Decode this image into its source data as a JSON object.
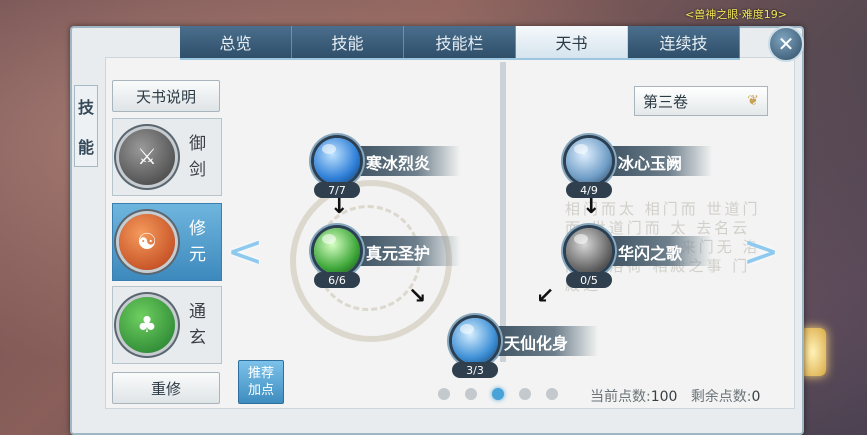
{
  "top_right_text": "<兽神之眼·难度19>",
  "tabs": [
    {
      "label": "总览"
    },
    {
      "label": "技能"
    },
    {
      "label": "技能栏"
    },
    {
      "label": "天书",
      "active": true
    },
    {
      "label": "连续技"
    }
  ],
  "side_title": [
    "技",
    "能"
  ],
  "left": {
    "explain_label": "天书说明",
    "schools": [
      {
        "name_line1": "御",
        "name_line2": "剑",
        "icon": "sword-emblem-icon",
        "color": "#4d4d4d"
      },
      {
        "name_line1": "修",
        "name_line2": "元",
        "icon": "fire-emblem-icon",
        "color": "#d8572a",
        "active": true
      },
      {
        "name_line1": "通",
        "name_line2": "玄",
        "icon": "nature-emblem-icon",
        "color": "#3b9a3d"
      }
    ],
    "reset_label": "重修",
    "recommend_line1": "推荐",
    "recommend_line2": "加点"
  },
  "volume": {
    "label": "第三卷",
    "icon": "chevron-down-icon"
  },
  "skills": [
    {
      "name": "寒冰烈炎",
      "level": "7/7",
      "color": "#2f7fd8"
    },
    {
      "name": "真元圣护",
      "level": "6/6",
      "color": "#3fa83a"
    },
    {
      "name": "天仙化身",
      "level": "3/3",
      "color": "#3d8fd6"
    },
    {
      "name": "冰心玉阙",
      "level": "4/9",
      "color": "#6f9dc6"
    },
    {
      "name": "华闪之歌",
      "level": "0/5",
      "color": "#6a6a6a"
    }
  ],
  "calligraphy": "相门而太 相门而 世道门而 世道门而 太 去名云 英太名云英太 来门无 洛门无 洛荷 相殿之事 门殿之",
  "pagination": {
    "count": 5,
    "active_index": 2
  },
  "points": {
    "current_label": "当前点数:",
    "current_value": "100",
    "remaining_label": "剩余点数:",
    "remaining_value": "0"
  }
}
